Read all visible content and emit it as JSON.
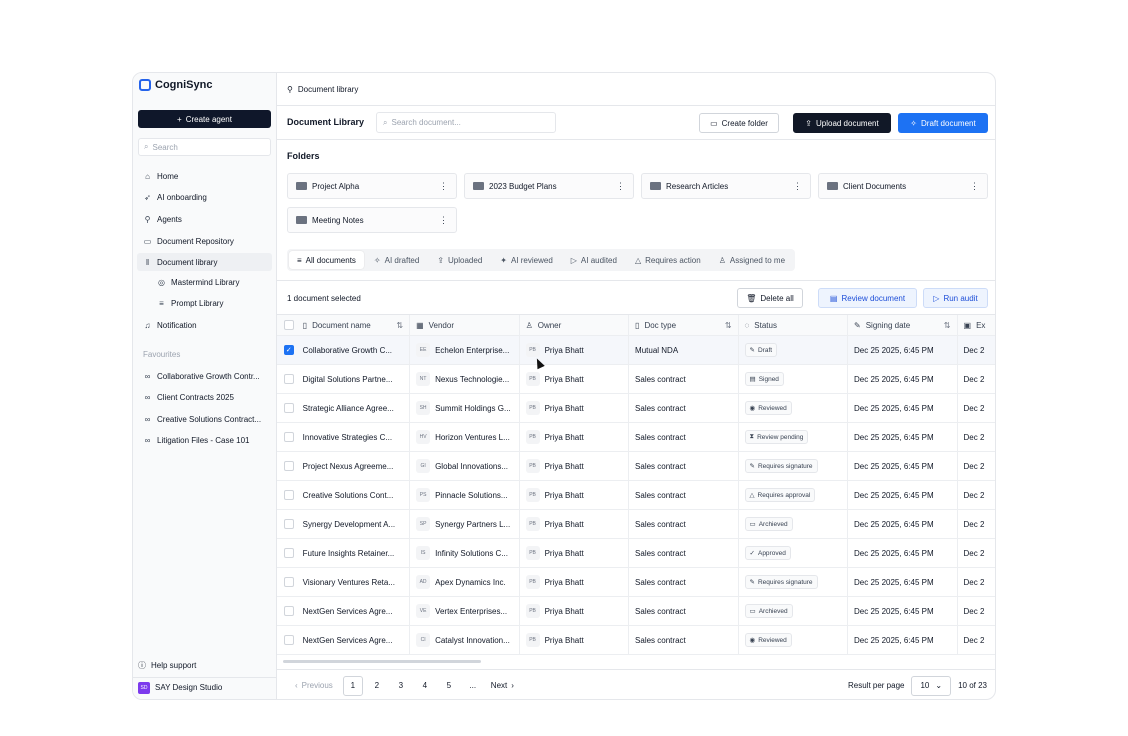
{
  "app": {
    "name": "CogniSync"
  },
  "sidebar": {
    "create_agent": "Create agent",
    "search_placeholder": "Search",
    "nav": [
      {
        "label": "Home",
        "icon": "home-icon"
      },
      {
        "label": "AI onboarding",
        "icon": "rocket-icon"
      },
      {
        "label": "Agents",
        "icon": "agents-icon"
      },
      {
        "label": "Document Repository",
        "icon": "folder-icon"
      },
      {
        "label": "Document library",
        "icon": "library-icon"
      },
      {
        "label": "Mastermind Library",
        "icon": "brain-icon"
      },
      {
        "label": "Prompt Library",
        "icon": "list-icon"
      },
      {
        "label": "Notification",
        "icon": "bell-icon"
      }
    ],
    "favourites_title": "Favourites",
    "favourites": [
      "Collaborative Growth Contr...",
      "Client Contracts 2025",
      "Creative Solutions Contract...",
      "Litigation Files - Case 101"
    ],
    "help": "Help support",
    "workspace": {
      "initials": "SD",
      "name": "SAY Design Studio"
    }
  },
  "topbar": {
    "breadcrumb": "Document library"
  },
  "header": {
    "title": "Document Library",
    "search_placeholder": "Search document...",
    "create_folder": "Create folder",
    "upload": "Upload document",
    "draft": "Draft document"
  },
  "folders": {
    "title": "Folders",
    "items": [
      "Project Alpha",
      "2023 Budget Plans",
      "Research Articles",
      "Client Documents",
      "Meeting Notes"
    ]
  },
  "tabs": [
    "All documents",
    "AI drafted",
    "Uploaded",
    "AI reviewed",
    "AI audited",
    "Requires action",
    "Assigned to me"
  ],
  "selection": {
    "text": "1 document selected",
    "delete_all": "Delete all",
    "review": "Review document",
    "run_audit": "Run audit"
  },
  "table": {
    "columns": [
      "Document name",
      "Vendor",
      "Owner",
      "Doc type",
      "Status",
      "Signing date",
      "Ex"
    ],
    "rows": [
      {
        "name": "Collaborative Growth C...",
        "vi": "EE",
        "vendor": "Echelon Enterprise...",
        "oi": "PB",
        "owner": "Priya Bhatt",
        "type": "Mutual NDA",
        "status": "Draft",
        "date": "Dec 25 2025, 6:45 PM",
        "exp": "Dec 2",
        "checked": true
      },
      {
        "name": "Digital Solutions Partne...",
        "vi": "NT",
        "vendor": "Nexus Technologie...",
        "oi": "PB",
        "owner": "Priya Bhatt",
        "type": "Sales contract",
        "status": "Signed",
        "date": "Dec 25 2025, 6:45 PM",
        "exp": "Dec 2",
        "checked": false
      },
      {
        "name": "Strategic Alliance Agree...",
        "vi": "SH",
        "vendor": "Summit Holdings G...",
        "oi": "PB",
        "owner": "Priya Bhatt",
        "type": "Sales contract",
        "status": "Reviewed",
        "date": "Dec 25 2025, 6:45 PM",
        "exp": "Dec 2",
        "checked": false
      },
      {
        "name": "Innovative Strategies C...",
        "vi": "HV",
        "vendor": "Horizon Ventures L...",
        "oi": "PB",
        "owner": "Priya Bhatt",
        "type": "Sales contract",
        "status": "Review pending",
        "date": "Dec 25 2025, 6:45 PM",
        "exp": "Dec 2",
        "checked": false
      },
      {
        "name": "Project Nexus Agreeme...",
        "vi": "GI",
        "vendor": "Global Innovations...",
        "oi": "PB",
        "owner": "Priya Bhatt",
        "type": "Sales contract",
        "status": "Requires signature",
        "date": "Dec 25 2025, 6:45 PM",
        "exp": "Dec 2",
        "checked": false
      },
      {
        "name": "Creative Solutions Cont...",
        "vi": "PS",
        "vendor": "Pinnacle Solutions...",
        "oi": "PB",
        "owner": "Priya Bhatt",
        "type": "Sales contract",
        "status": "Requires approval",
        "date": "Dec 25 2025, 6:45 PM",
        "exp": "Dec 2",
        "checked": false
      },
      {
        "name": "Synergy Development A...",
        "vi": "SP",
        "vendor": "Synergy Partners L...",
        "oi": "PB",
        "owner": "Priya Bhatt",
        "type": "Sales contract",
        "status": "Archieved",
        "date": "Dec 25 2025, 6:45 PM",
        "exp": "Dec 2",
        "checked": false
      },
      {
        "name": "Future Insights Retainer...",
        "vi": "IS",
        "vendor": "Infinity Solutions C...",
        "oi": "PB",
        "owner": "Priya Bhatt",
        "type": "Sales contract",
        "status": "Approved",
        "date": "Dec 25 2025, 6:45 PM",
        "exp": "Dec 2",
        "checked": false
      },
      {
        "name": "Visionary Ventures Reta...",
        "vi": "AD",
        "vendor": "Apex Dynamics Inc.",
        "oi": "PB",
        "owner": "Priya Bhatt",
        "type": "Sales contract",
        "status": "Requires signature",
        "date": "Dec 25 2025, 6:45 PM",
        "exp": "Dec 2",
        "checked": false
      },
      {
        "name": "NextGen Services Agre...",
        "vi": "VE",
        "vendor": "Vertex Enterprises...",
        "oi": "PB",
        "owner": "Priya Bhatt",
        "type": "Sales contract",
        "status": "Archieved",
        "date": "Dec 25 2025, 6:45 PM",
        "exp": "Dec 2",
        "checked": false
      },
      {
        "name": "NextGen Services Agre...",
        "vi": "CI",
        "vendor": "Catalyst Innovation...",
        "oi": "PB",
        "owner": "Priya Bhatt",
        "type": "Sales contract",
        "status": "Reviewed",
        "date": "Dec 25 2025, 6:45 PM",
        "exp": "Dec 2",
        "checked": false
      }
    ]
  },
  "pagination": {
    "previous": "Previous",
    "pages": [
      "1",
      "2",
      "3",
      "4",
      "5",
      "..."
    ],
    "current": "1",
    "next": "Next",
    "per_page_label": "Result per page",
    "per_page": "10",
    "range": "10 of 23"
  }
}
